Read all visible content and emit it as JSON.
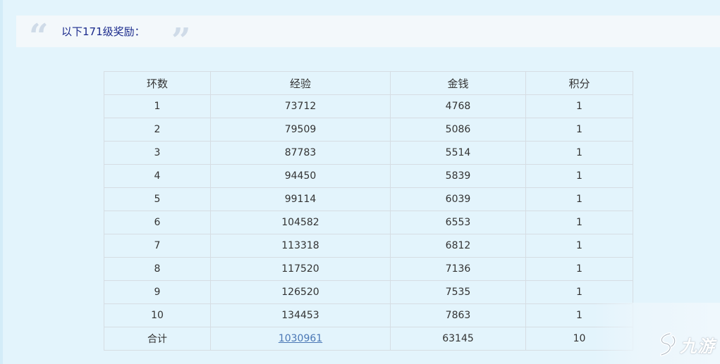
{
  "quote": {
    "open_mark": "“",
    "close_mark": "”",
    "text": "以下171级奖励："
  },
  "table": {
    "headers": [
      "环数",
      "经验",
      "金钱",
      "积分"
    ],
    "rows": [
      [
        "1",
        "73712",
        "4768",
        "1"
      ],
      [
        "2",
        "79509",
        "5086",
        "1"
      ],
      [
        "3",
        "87783",
        "5514",
        "1"
      ],
      [
        "4",
        "94450",
        "5839",
        "1"
      ],
      [
        "5",
        "99114",
        "6039",
        "1"
      ],
      [
        "6",
        "104582",
        "6553",
        "1"
      ],
      [
        "7",
        "113318",
        "6812",
        "1"
      ],
      [
        "8",
        "117520",
        "7136",
        "1"
      ],
      [
        "9",
        "126520",
        "7535",
        "1"
      ],
      [
        "10",
        "134453",
        "7863",
        "1"
      ]
    ],
    "total": {
      "label": "合计",
      "exp": "1030961",
      "money": "63145",
      "points": "10"
    }
  },
  "watermark": {
    "icon": "jiuyou-logo-icon",
    "text": "九游"
  },
  "colors": {
    "page_background": "#e3f4fc",
    "quote_text": "#1a2a8c",
    "link": "#4a77b5"
  }
}
